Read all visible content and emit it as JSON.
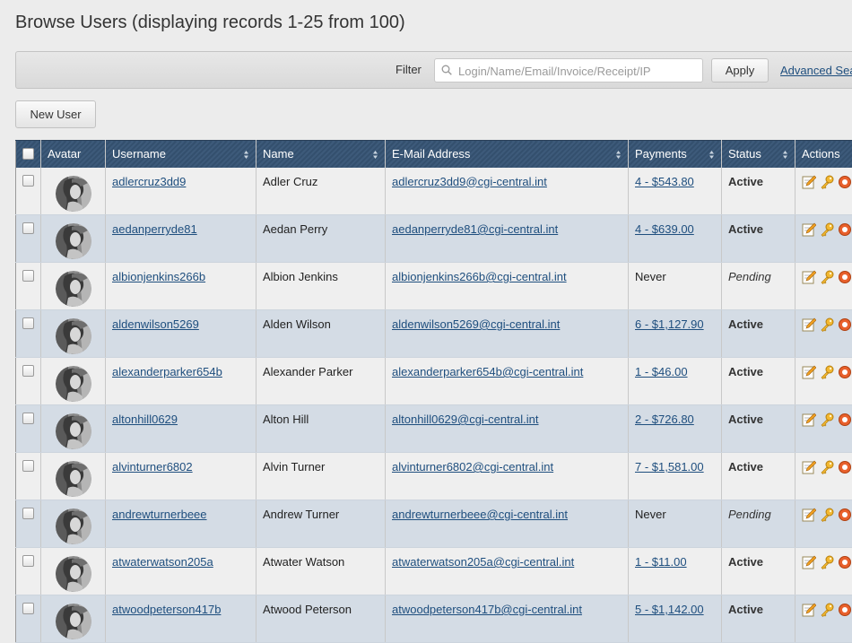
{
  "page": {
    "title": "Browse Users (displaying records 1-25 from 100)"
  },
  "filter": {
    "label": "Filter",
    "placeholder": "Login/Name/Email/Invoice/Receipt/IP",
    "apply_label": "Apply",
    "advanced_label": "Advanced Search"
  },
  "toolbar": {
    "new_user_label": "New User"
  },
  "table": {
    "columns": [
      "Avatar",
      "Username",
      "Name",
      "E-Mail Address",
      "Payments",
      "Status",
      "Actions"
    ],
    "rows": [
      {
        "username": "adlercruz3dd9",
        "name": "Adler Cruz",
        "email": "adlercruz3dd9@cgi-central.int",
        "payments": "4 - $543.80",
        "status": "Active"
      },
      {
        "username": "aedanperryde81",
        "name": "Aedan Perry",
        "email": "aedanperryde81@cgi-central.int",
        "payments": "4 - $639.00",
        "status": "Active"
      },
      {
        "username": "albionjenkins266b",
        "name": "Albion Jenkins",
        "email": "albionjenkins266b@cgi-central.int",
        "payments": "Never",
        "status": "Pending"
      },
      {
        "username": "aldenwilson5269",
        "name": "Alden Wilson",
        "email": "aldenwilson5269@cgi-central.int",
        "payments": "6 - $1,127.90",
        "status": "Active"
      },
      {
        "username": "alexanderparker654b",
        "name": "Alexander Parker",
        "email": "alexanderparker654b@cgi-central.int",
        "payments": "1 - $46.00",
        "status": "Active"
      },
      {
        "username": "altonhill0629",
        "name": "Alton Hill",
        "email": "altonhill0629@cgi-central.int",
        "payments": "2 - $726.80",
        "status": "Active"
      },
      {
        "username": "alvinturner6802",
        "name": "Alvin Turner",
        "email": "alvinturner6802@cgi-central.int",
        "payments": "7 - $1,581.00",
        "status": "Active"
      },
      {
        "username": "andrewturnerbeee",
        "name": "Andrew Turner",
        "email": "andrewturnerbeee@cgi-central.int",
        "payments": "Never",
        "status": "Pending"
      },
      {
        "username": "atwaterwatson205a",
        "name": "Atwater Watson",
        "email": "atwaterwatson205a@cgi-central.int",
        "payments": "1 - $11.00",
        "status": "Active"
      },
      {
        "username": "atwoodpeterson417b",
        "name": "Atwood Peterson",
        "email": "atwoodpeterson417b@cgi-central.int",
        "payments": "5 - $1,142.00",
        "status": "Active"
      }
    ]
  },
  "icons": {
    "avatar": "avatar-image",
    "edit": "edit-icon",
    "login_as": "key-icon",
    "more": "lifebuoy-icon"
  },
  "colors": {
    "header_bg": "#3d5a7a",
    "link": "#1e4e7e",
    "row_alt": "#d4dce5",
    "row": "#efefef"
  }
}
